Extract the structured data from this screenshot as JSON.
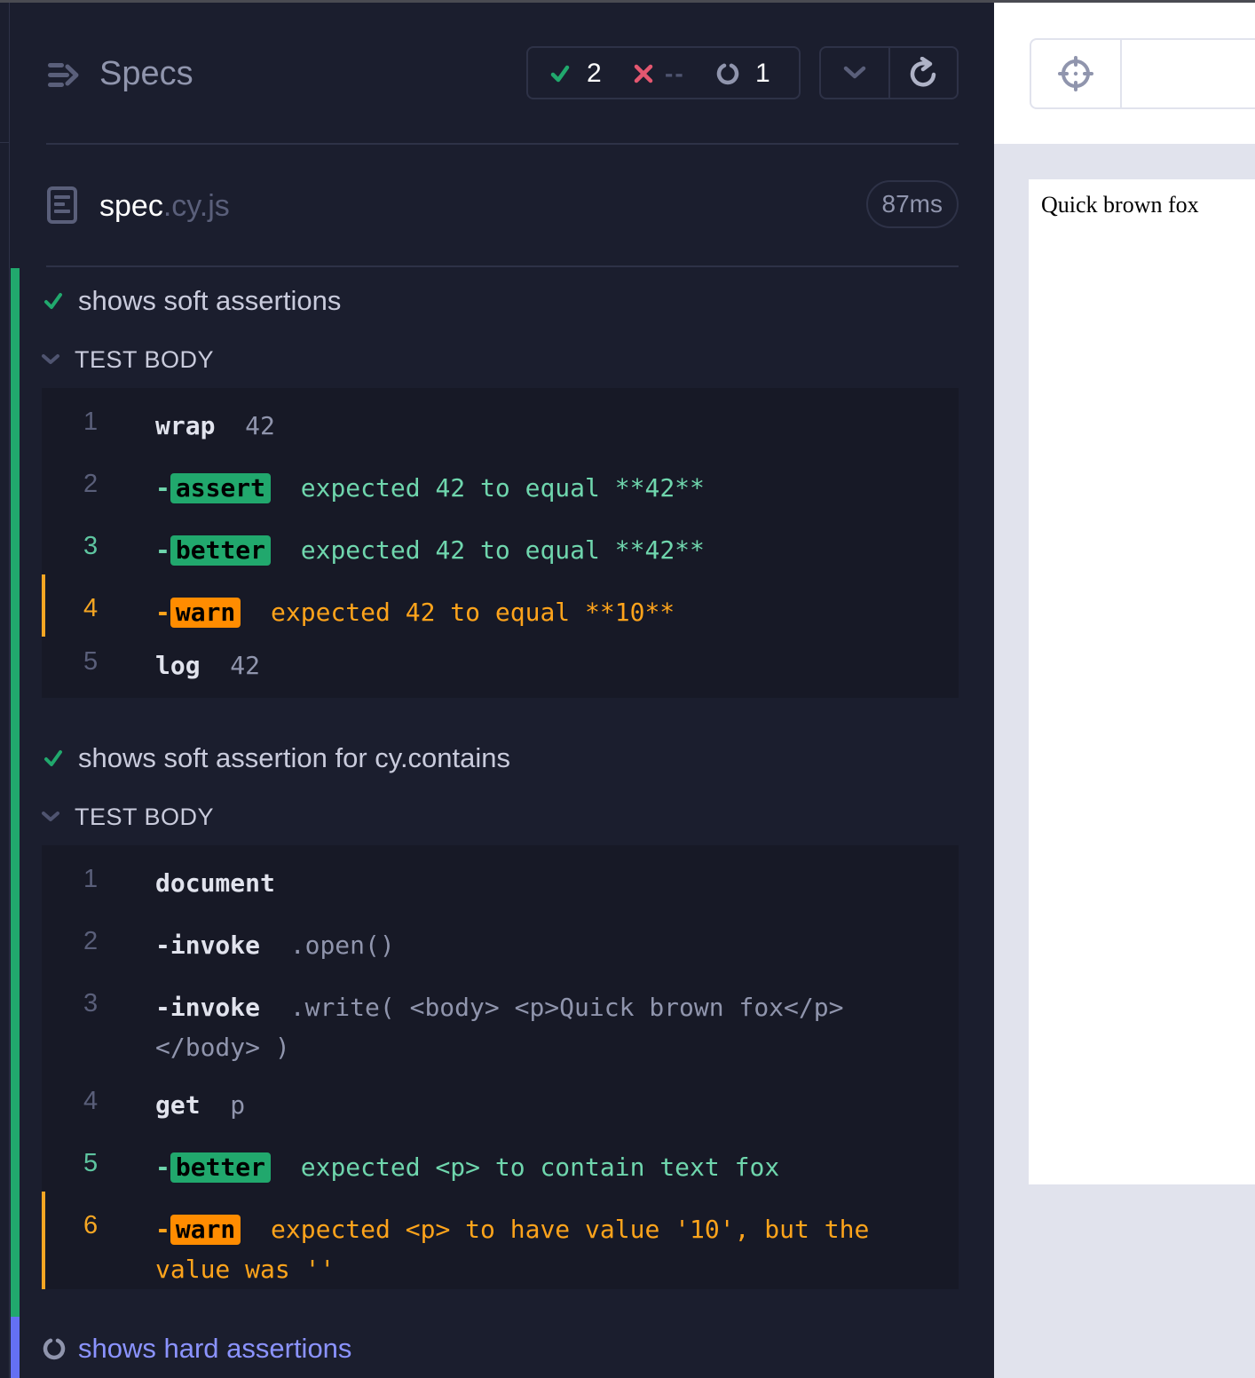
{
  "header": {
    "title": "Specs",
    "stats": {
      "passed": "2",
      "failed": "--",
      "pending": "1"
    }
  },
  "spec": {
    "name": "spec",
    "ext": ".cy.js",
    "duration": "87ms"
  },
  "tests": [
    {
      "title": "shows soft assertions",
      "state": "passed",
      "body_label": "TEST BODY",
      "commands": [
        {
          "num": "1",
          "name": "wrap",
          "message": "42",
          "type": "normal"
        },
        {
          "num": "2",
          "badge": "assert",
          "message": "expected 42 to equal **42**",
          "type": "assert"
        },
        {
          "num": "3",
          "badge": "better",
          "message": "expected 42 to equal **42**",
          "type": "pass"
        },
        {
          "num": "4",
          "badge": "warn",
          "message": "expected 42 to equal **10**",
          "type": "warn"
        },
        {
          "num": "5",
          "name": "log",
          "message": "42",
          "type": "normal"
        }
      ]
    },
    {
      "title": "shows soft assertion for cy.contains",
      "state": "passed",
      "body_label": "TEST BODY",
      "commands": [
        {
          "num": "1",
          "name": "document",
          "message": "",
          "type": "normal"
        },
        {
          "num": "2",
          "name": "-invoke",
          "message": ".open()",
          "type": "normal"
        },
        {
          "num": "3",
          "name": "-invoke",
          "message": ".write( <body> <p>Quick brown fox</p> </body> )",
          "type": "normal"
        },
        {
          "num": "4",
          "name": "get",
          "message": "p",
          "type": "normal"
        },
        {
          "num": "5",
          "badge": "better",
          "message": "expected <p> to contain text fox",
          "type": "pass"
        },
        {
          "num": "6",
          "badge": "warn",
          "message": "expected <p> to have value '10', but the value was ''",
          "type": "warn"
        }
      ]
    },
    {
      "title": "shows hard assertions",
      "state": "running"
    }
  ],
  "aut": {
    "content": "Quick brown fox"
  },
  "colors": {
    "passed": "#21a86d",
    "failed": "#e45770",
    "warn": "#ff8c00",
    "running": "#6470f3",
    "background": "#1b1e2e"
  }
}
